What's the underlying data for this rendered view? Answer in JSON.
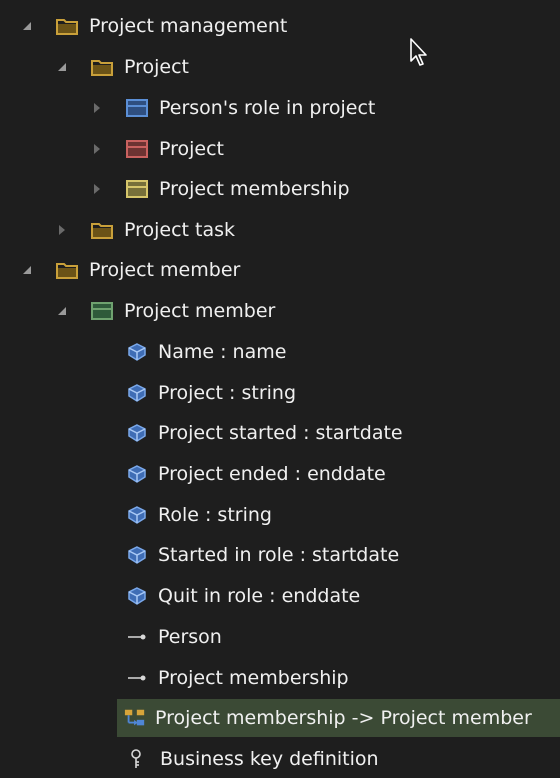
{
  "tree": {
    "nodes": [
      {
        "label": "Project management",
        "icon": "folder-icon",
        "arrow": "expanded"
      },
      {
        "label": "Project",
        "icon": "folder-icon",
        "arrow": "expanded"
      },
      {
        "label": "Person's role in project",
        "icon": "entity-blue-icon",
        "arrow": "collapsed"
      },
      {
        "label": "Project",
        "icon": "entity-red-icon",
        "arrow": "collapsed"
      },
      {
        "label": "Project membership",
        "icon": "entity-yellow-icon",
        "arrow": "collapsed"
      },
      {
        "label": "Project task",
        "icon": "folder-icon",
        "arrow": "collapsed"
      },
      {
        "label": "Project member",
        "icon": "folder-icon",
        "arrow": "expanded"
      },
      {
        "label": "Project member",
        "icon": "entity-green-icon",
        "arrow": "expanded"
      },
      {
        "label": "Name : name",
        "icon": "attribute-icon",
        "arrow": "none"
      },
      {
        "label": "Project : string",
        "icon": "attribute-icon",
        "arrow": "none"
      },
      {
        "label": "Project started : startdate",
        "icon": "attribute-icon",
        "arrow": "none"
      },
      {
        "label": "Project ended : enddate",
        "icon": "attribute-icon",
        "arrow": "none"
      },
      {
        "label": "Role : string",
        "icon": "attribute-icon",
        "arrow": "none"
      },
      {
        "label": "Started in role : startdate",
        "icon": "attribute-icon",
        "arrow": "none"
      },
      {
        "label": "Quit in role : enddate",
        "icon": "attribute-icon",
        "arrow": "none"
      },
      {
        "label": "Person",
        "icon": "reference-icon",
        "arrow": "none"
      },
      {
        "label": "Project membership",
        "icon": "reference-icon",
        "arrow": "none"
      },
      {
        "label": "Project membership -> Project member",
        "icon": "relationship-icon",
        "arrow": "none",
        "selected": true
      },
      {
        "label": "Business key definition",
        "icon": "key-icon",
        "arrow": "none"
      }
    ]
  },
  "colors": {
    "background": "#1e1e1e",
    "text": "#f0f0f0",
    "selected_row": "#3b4a35",
    "folder": "#c9a03a",
    "entity_blue": "#5b8fd6",
    "entity_red": "#c9615f",
    "entity_yellow": "#d6c66b",
    "entity_green": "#6fa26f",
    "attribute": "#5a8ed8"
  }
}
